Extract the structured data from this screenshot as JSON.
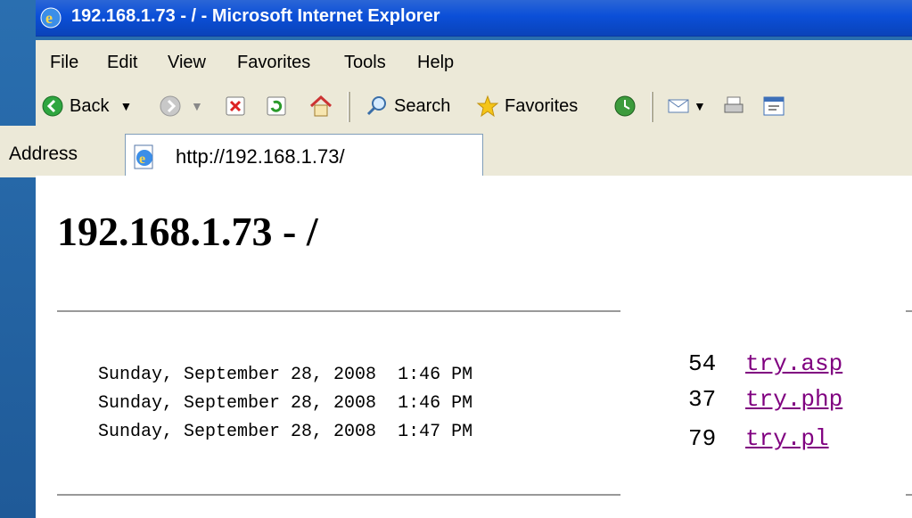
{
  "window": {
    "title": "192.168.1.73 - / - Microsoft Internet Explorer"
  },
  "menu": [
    "File",
    "Edit",
    "View",
    "Favorites",
    "Tools",
    "Help"
  ],
  "toolbar": {
    "back_label": "Back",
    "search_label": "Search",
    "favorites_label": "Favorites"
  },
  "address": {
    "label": "Address",
    "url": "http://192.168.1.73/"
  },
  "page": {
    "heading": "192.168.1.73 - /",
    "entries": [
      {
        "date": "Sunday, September 28, 2008",
        "time": "1:46 PM",
        "size": "54",
        "name": "try.asp"
      },
      {
        "date": "Sunday, September 28, 2008",
        "time": "1:46 PM",
        "size": "37",
        "name": "try.php"
      },
      {
        "date": "Sunday, September 28, 2008",
        "time": "1:47 PM",
        "size": "79",
        "name": "try.pl"
      }
    ]
  },
  "colors": {
    "titlebar": "#0b4fd8",
    "chrome": "#ece9d8",
    "visited_link": "#800080"
  }
}
